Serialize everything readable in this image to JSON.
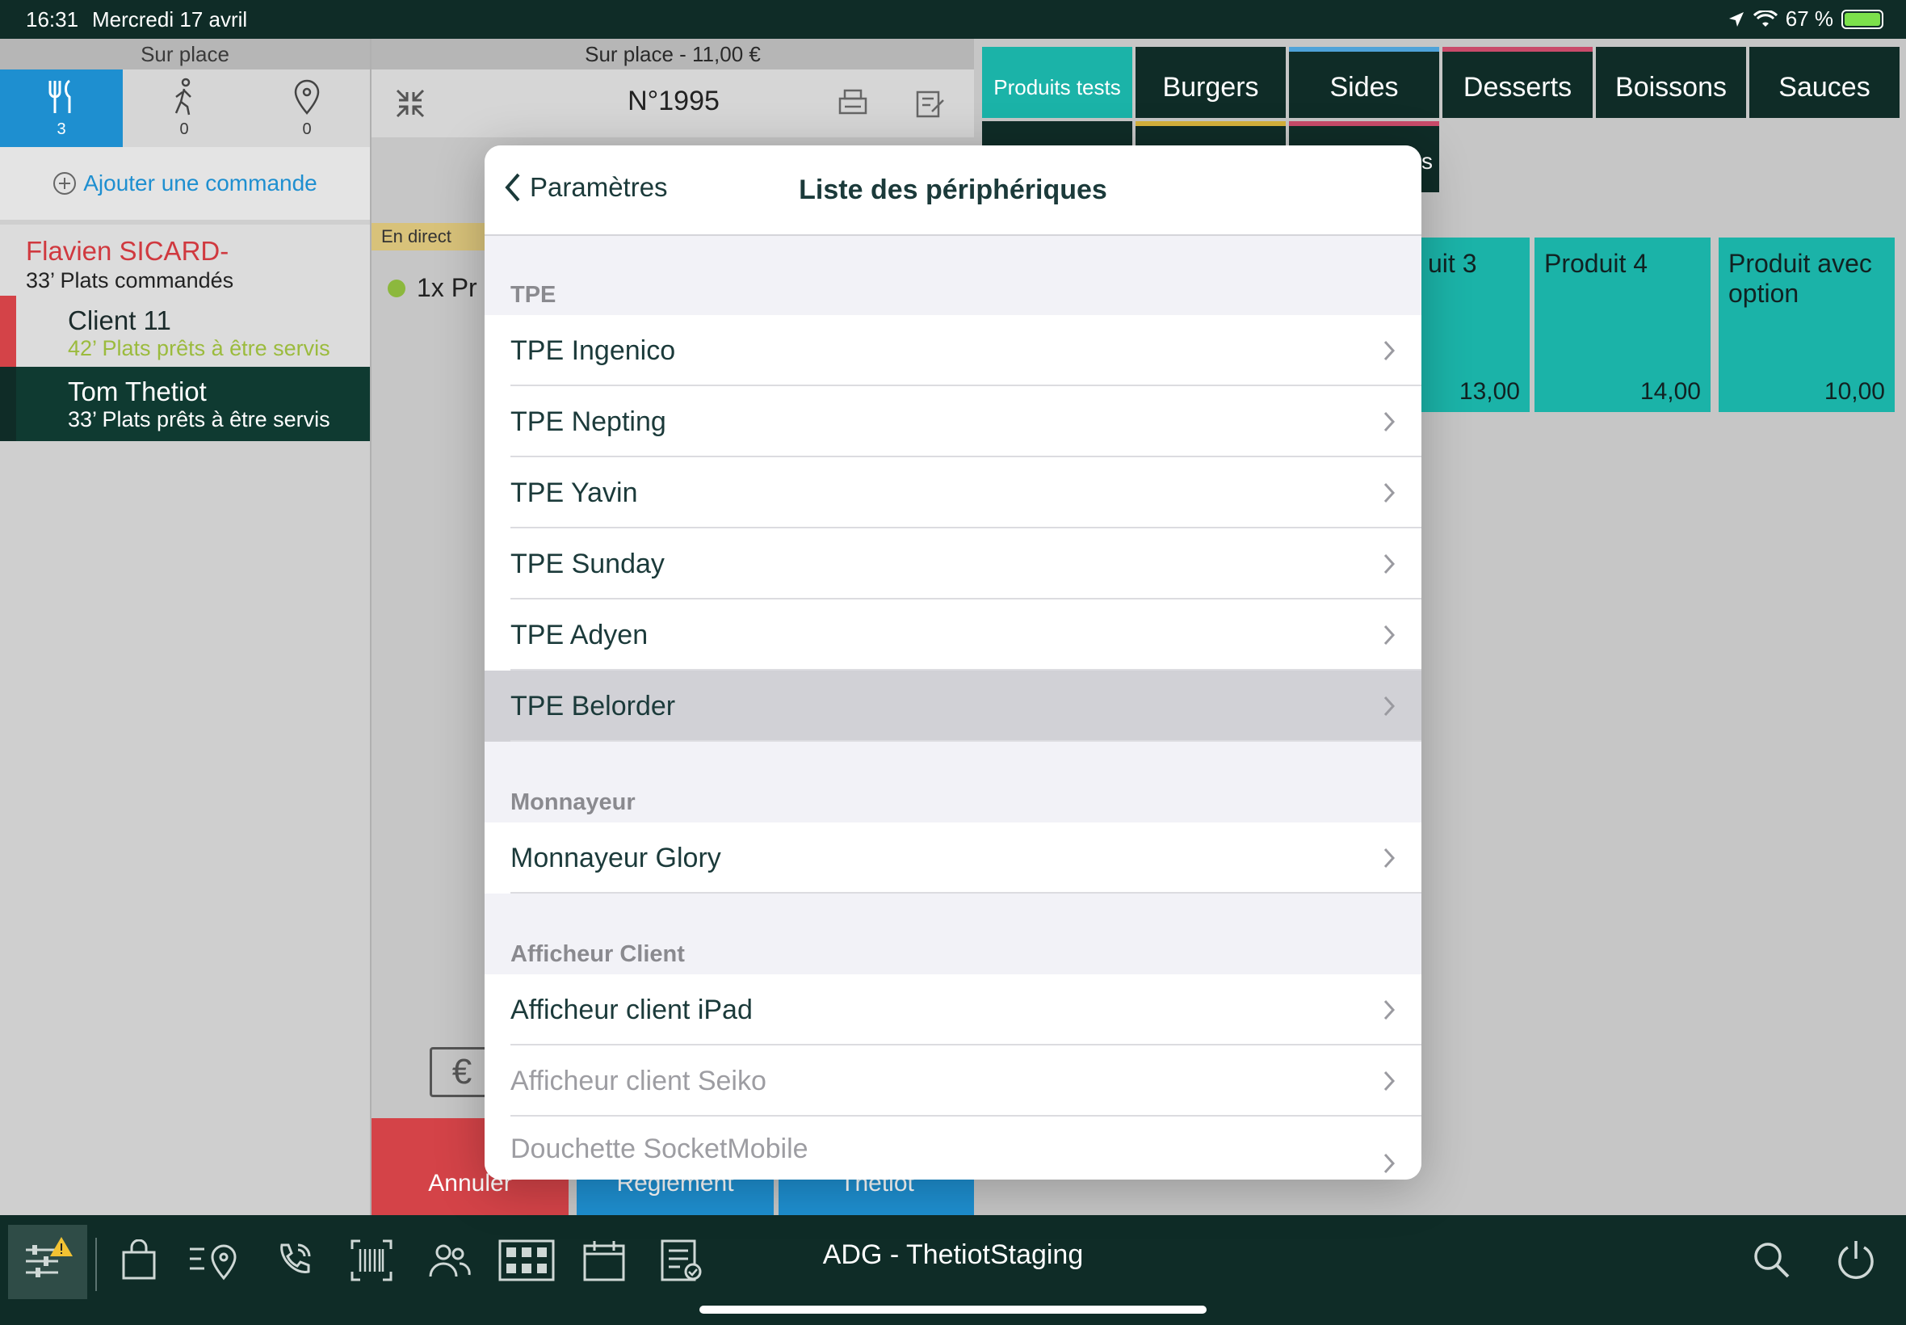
{
  "status": {
    "time": "16:31",
    "date": "Mercredi 17 avril",
    "battery": "67 %",
    "battery_level": 0.67
  },
  "left": {
    "header": "Sur place",
    "modes": [
      {
        "icon": "fork-knife-icon",
        "count": "3"
      },
      {
        "icon": "walking-icon",
        "count": "0"
      },
      {
        "icon": "location-pin-icon",
        "count": "0"
      }
    ],
    "add_order": "Ajouter une commande",
    "clients": [
      {
        "name": "Flavien SICARD-",
        "sub": "33’ Plats commandés"
      },
      {
        "name": "Client 11",
        "sub": "42’ Plats prêts à être servis"
      },
      {
        "name": "Tom Thetiot",
        "sub": "33’ Plats prêts à être servis"
      }
    ]
  },
  "middle": {
    "header": "Sur place - 11,00 €",
    "order_number": "N°1995",
    "live_label": "En direct",
    "order_line": "1x Pr",
    "buttons": {
      "cancel": "Annuler",
      "pay": "Réglement",
      "user": "Thetiot"
    }
  },
  "categories": [
    "Produits tests",
    "Burgers",
    "Sides",
    "Desserts",
    "Boissons",
    "Sauces"
  ],
  "category_partial": "s",
  "products": [
    {
      "name": "uit 3",
      "price": "13,00"
    },
    {
      "name": "Produit 4",
      "price": "14,00"
    },
    {
      "name": "Produit avec option",
      "price": "10,00"
    }
  ],
  "modal": {
    "back_label": "Paramètres",
    "title": "Liste des périphériques",
    "sections": [
      {
        "label": "TPE",
        "items": [
          "TPE Ingenico",
          "TPE Nepting",
          "TPE Yavin",
          "TPE Sunday",
          "TPE Adyen",
          "TPE Belorder"
        ]
      },
      {
        "label": "Monnayeur",
        "items": [
          "Monnayeur Glory"
        ]
      },
      {
        "label": "Afficheur Client",
        "items": [
          "Afficheur client iPad",
          "Afficheur client Seiko",
          "Douchette SocketMobile"
        ]
      }
    ],
    "selected_item": "TPE Belorder"
  },
  "bottom": {
    "venue": "ADG - ThetiotStaging"
  },
  "colors": {
    "dark_green": "#0f2c27",
    "teal": "#1bb3a8",
    "blue": "#1e8fd0",
    "red": "#d44348"
  }
}
